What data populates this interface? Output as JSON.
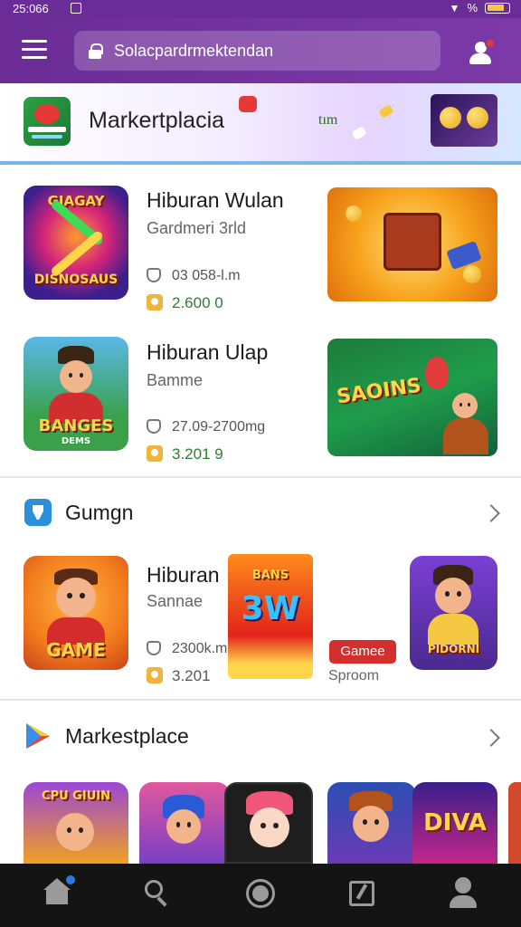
{
  "status_bar": {
    "time": "25:066",
    "battery_label": "%"
  },
  "app_bar": {
    "search_text": "Solacpardrmektendan"
  },
  "banner": {
    "title": "Markertplacia",
    "subtitle": "tım"
  },
  "featured_list": [
    {
      "title": "Hiburan Wulan",
      "subtitle": "Gardmeri 3rld",
      "size": "03 058-l.m",
      "rating": "2.600 0",
      "icon_caption": "DISNOSAUS",
      "icon_top_caption": "GIAGAY"
    },
    {
      "title": "Hiburan Ulap",
      "subtitle": "Bamme",
      "size": "27.09-2700mg",
      "rating": "3.201 9",
      "icon_caption": "BANGES",
      "icon_sub_caption": "DEMS",
      "art_caption": "SAOINS"
    }
  ],
  "section_gumgn": {
    "title": "Gumgn",
    "item": {
      "title": "Hiburan",
      "subtitle": "Sannae",
      "size": "2300k.mg",
      "rating": "3.201",
      "icon_caption": "GAME",
      "center_caption": "3W",
      "center_top_caption": "BANS",
      "tag_label": "Gamee",
      "tag_sub": "Sproom",
      "right_caption": "PIDORNI"
    }
  },
  "section_marketplace": {
    "title": "Markestplace",
    "tiles": [
      {
        "caption": "CPU GIUIN"
      },
      {
        "caption": ""
      },
      {
        "caption": ""
      },
      {
        "caption": ""
      },
      {
        "caption": "DIVA"
      }
    ]
  },
  "colors": {
    "brand_purple": "#6b2c96",
    "banner_underline": "#7ab6e8",
    "rating_green": "#2e7d32",
    "tag_red": "#d32f2f",
    "nav_bg": "#141414"
  },
  "icons": [
    "menu-icon",
    "lock-icon",
    "user-notify-icon",
    "shield-icon",
    "rating-icon",
    "chevron-right-icon",
    "play-store-icon",
    "home-icon",
    "search-icon",
    "record-icon",
    "edit-icon",
    "profile-icon"
  ]
}
